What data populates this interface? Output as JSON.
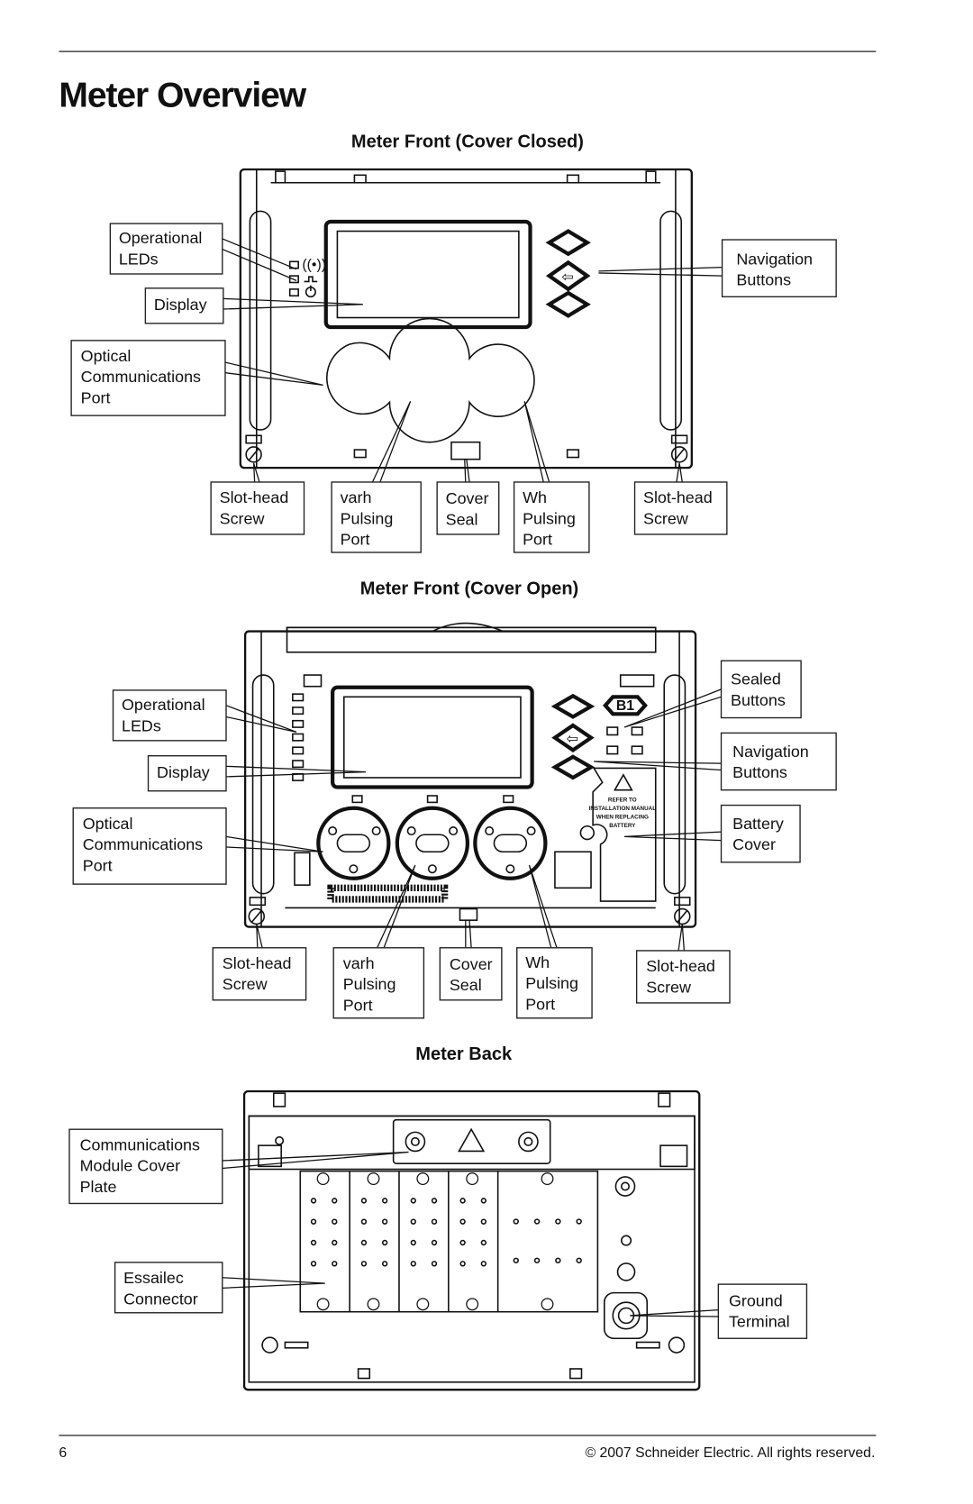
{
  "page": {
    "title": "Meter Overview",
    "page_number": "6",
    "copyright": "© 2007 Schneider Electric.  All rights reserved."
  },
  "cover_closed": {
    "heading": "Meter Front (Cover Closed)",
    "labels": {
      "operational_leds": [
        "Operational",
        "LEDs"
      ],
      "display": [
        "Display"
      ],
      "optical_port": [
        "Optical",
        "Communications",
        "Port"
      ],
      "navigation_buttons": [
        "Navigation",
        "Buttons"
      ],
      "slot_head_left": [
        "Slot-head",
        "Screw"
      ],
      "varh_port": [
        "varh",
        "Pulsing",
        "Port"
      ],
      "cover_seal": [
        "Cover",
        "Seal"
      ],
      "wh_port": [
        "Wh",
        "Pulsing",
        "Port"
      ],
      "slot_head_right": [
        "Slot-head",
        "Screw"
      ]
    }
  },
  "cover_open": {
    "heading": "Meter Front (Cover Open)",
    "sealed_button_text": "B1",
    "battery_notice": [
      "REFER TO",
      "INSTALLATION MANUAL",
      "WHEN REPLACING",
      "BATTERY"
    ],
    "labels": {
      "operational_leds": [
        "Operational",
        "LEDs"
      ],
      "display": [
        "Display"
      ],
      "optical_port": [
        "Optical",
        "Communications",
        "Port"
      ],
      "sealed_buttons": [
        "Sealed",
        "Buttons"
      ],
      "navigation_buttons": [
        "Navigation",
        "Buttons"
      ],
      "battery_cover": [
        "Battery",
        "Cover"
      ],
      "slot_head_left": [
        "Slot-head",
        "Screw"
      ],
      "varh_port": [
        "varh",
        "Pulsing",
        "Port"
      ],
      "cover_seal": [
        "Cover",
        "Seal"
      ],
      "wh_port": [
        "Wh",
        "Pulsing",
        "Port"
      ],
      "slot_head_right": [
        "Slot-head",
        "Screw"
      ]
    }
  },
  "back": {
    "heading": "Meter Back",
    "labels": {
      "comm_module": [
        "Communications",
        "Module Cover",
        "Plate"
      ],
      "essailec": [
        "Essailec",
        "Connector"
      ],
      "ground": [
        "Ground",
        "Terminal"
      ]
    }
  }
}
